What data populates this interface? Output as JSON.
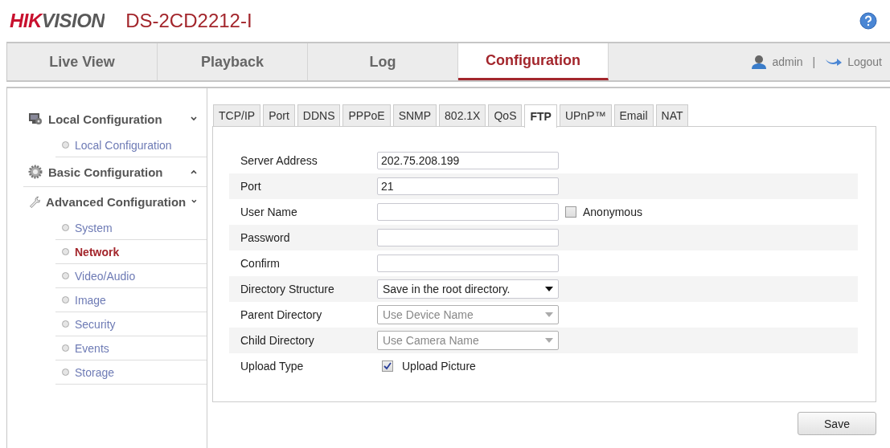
{
  "header": {
    "logo": "HIKVISION",
    "model": "DS-2CD2212-I"
  },
  "nav": {
    "tabs": [
      {
        "label": "Live View",
        "selected": false
      },
      {
        "label": "Playback",
        "selected": false
      },
      {
        "label": "Log",
        "selected": false
      },
      {
        "label": "Configuration",
        "selected": true
      }
    ],
    "user": "admin",
    "separator": "|",
    "logout": "Logout"
  },
  "sidebar": {
    "groups": [
      {
        "label": "Local Configuration",
        "kind": "monitor",
        "expanded": true,
        "children": [
          {
            "label": "Local Configuration",
            "selected": false
          }
        ]
      },
      {
        "label": "Basic Configuration",
        "kind": "gear",
        "expanded": false
      },
      {
        "label": "Advanced Configuration",
        "kind": "wrench",
        "expanded": true,
        "children": [
          {
            "label": "System",
            "selected": false
          },
          {
            "label": "Network",
            "selected": true
          },
          {
            "label": "Video/Audio",
            "selected": false
          },
          {
            "label": "Image",
            "selected": false
          },
          {
            "label": "Security",
            "selected": false
          },
          {
            "label": "Events",
            "selected": false
          },
          {
            "label": "Storage",
            "selected": false
          }
        ]
      }
    ]
  },
  "tabs": [
    {
      "label": "TCP/IP",
      "selected": false
    },
    {
      "label": "Port",
      "selected": false
    },
    {
      "label": "DDNS",
      "selected": false
    },
    {
      "label": "PPPoE",
      "selected": false
    },
    {
      "label": "SNMP",
      "selected": false
    },
    {
      "label": "802.1X",
      "selected": false
    },
    {
      "label": "QoS",
      "selected": false
    },
    {
      "label": "FTP",
      "selected": true
    },
    {
      "label": "UPnP™",
      "selected": false
    },
    {
      "label": "Email",
      "selected": false
    },
    {
      "label": "NAT",
      "selected": false
    }
  ],
  "form": [
    {
      "kind": "text",
      "label": "Server Address",
      "value": "202.75.208.199"
    },
    {
      "kind": "text",
      "label": "Port",
      "value": "21"
    },
    {
      "kind": "text",
      "label": "User Name",
      "checkbox": {
        "label": "Anonymous",
        "checked": false
      }
    },
    {
      "kind": "text",
      "label": "Password"
    },
    {
      "kind": "text",
      "label": "Confirm"
    },
    {
      "kind": "select",
      "label": "Directory Structure",
      "value": "Save in the root directory.",
      "disabled": false
    },
    {
      "kind": "select",
      "label": "Parent Directory",
      "value": "Use Device Name",
      "disabled": true
    },
    {
      "kind": "select",
      "label": "Child Directory",
      "value": "Use Camera Name",
      "disabled": true
    },
    {
      "kind": "checkbox",
      "label": "Upload Type",
      "checkbox": {
        "label": "Upload Picture",
        "checked": true
      }
    }
  ],
  "save": "Save"
}
